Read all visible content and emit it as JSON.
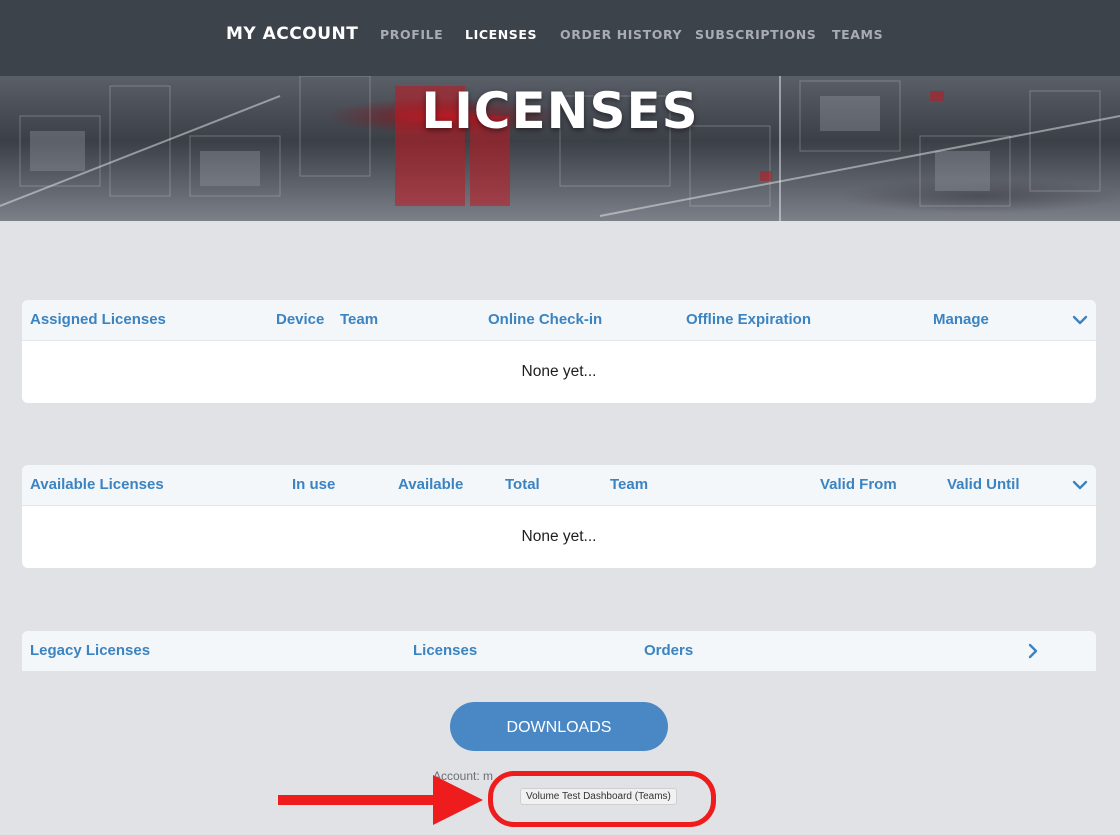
{
  "nav": {
    "brand": "MY ACCOUNT",
    "links": [
      {
        "label": "PROFILE",
        "active": false
      },
      {
        "label": "LICENSES",
        "active": true
      },
      {
        "label": "ORDER HISTORY",
        "active": false
      },
      {
        "label": "SUBSCRIPTIONS",
        "active": false
      },
      {
        "label": "TEAMS",
        "active": false
      }
    ]
  },
  "hero": {
    "title": "LICENSES"
  },
  "assigned": {
    "columns": [
      "Assigned Licenses",
      "Device",
      "Team",
      "Online Check-in",
      "Offline Expiration",
      "Manage"
    ],
    "empty": "None yet...",
    "toggle_icon": "chevron-down-icon"
  },
  "available": {
    "columns": [
      "Available Licenses",
      "In use",
      "Available",
      "Total",
      "Team",
      "Valid From",
      "Valid Until"
    ],
    "empty": "None yet...",
    "toggle_icon": "chevron-down-icon"
  },
  "legacy": {
    "columns": [
      "Legacy Licenses",
      "Licenses",
      "Orders"
    ],
    "toggle_icon": "chevron-right-icon"
  },
  "downloads_label": "DOWNLOADS",
  "account_line": "Account: m",
  "team_label": "Volume Test Dashboard (Teams)",
  "colors": {
    "nav_bg": "#3d434b",
    "accent": "#3b83c1",
    "button": "#4a88c5",
    "highlight": "#ee1c1c"
  }
}
